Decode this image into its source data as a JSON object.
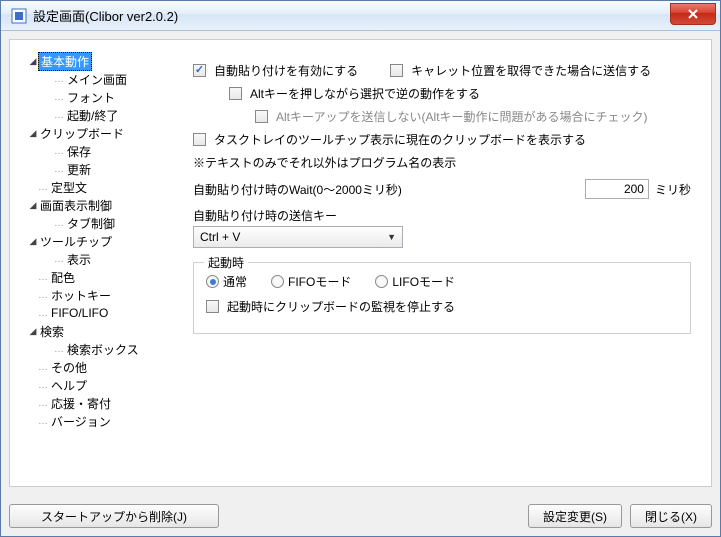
{
  "window": {
    "title": "設定画面(Clibor ver2.0.2)"
  },
  "tree": {
    "items": [
      {
        "label": "基本動作",
        "level": 1,
        "expandable": true,
        "selected": true
      },
      {
        "label": "メイン画面",
        "level": 2
      },
      {
        "label": "フォント",
        "level": 2
      },
      {
        "label": "起動/終了",
        "level": 2
      },
      {
        "label": "クリップボード",
        "level": 1,
        "expandable": true
      },
      {
        "label": "保存",
        "level": 2
      },
      {
        "label": "更新",
        "level": 2
      },
      {
        "label": "定型文",
        "level": 1
      },
      {
        "label": "画面表示制御",
        "level": 1,
        "expandable": true
      },
      {
        "label": "タブ制御",
        "level": 2
      },
      {
        "label": "ツールチップ",
        "level": 1,
        "expandable": true
      },
      {
        "label": "表示",
        "level": 2
      },
      {
        "label": "配色",
        "level": 1
      },
      {
        "label": "ホットキー",
        "level": 1
      },
      {
        "label": "FIFO/LIFO",
        "level": 1
      },
      {
        "label": "検索",
        "level": 1,
        "expandable": true
      },
      {
        "label": "検索ボックス",
        "level": 2
      },
      {
        "label": "その他",
        "level": 1
      },
      {
        "label": "ヘルプ",
        "level": 1
      },
      {
        "label": "応援・寄付",
        "level": 1
      },
      {
        "label": "バージョン",
        "level": 1
      }
    ]
  },
  "content": {
    "cb_autopaste": "自動貼り付けを有効にする",
    "cb_caret": "キャレット位置を取得できた場合に送信する",
    "cb_alt_reverse": "Altキーを押しながら選択で逆の動作をする",
    "cb_alt_keyup": "Altキーアップを送信しない(Altキー動作に問題がある場合にチェック)",
    "cb_tooltip_clip": "タスクトレイのツールチップ表示に現在のクリップボードを表示する",
    "note_textonly": "※テキストのみでそれ以外はプログラム名の表示",
    "wait_label": "自動貼り付け時のWait(0～2000ミリ秒)",
    "wait_value": "200",
    "wait_unit": "ミリ秒",
    "sendkey_label": "自動貼り付け時の送信キー",
    "sendkey_value": "Ctrl + V",
    "startup": {
      "legend": "起動時",
      "r_normal": "通常",
      "r_fifo": "FIFOモード",
      "r_lifo": "LIFOモード",
      "cb_stop_monitor": "起動時にクリップボードの監視を停止する"
    }
  },
  "buttons": {
    "delete_startup": "スタートアップから削除(J)",
    "apply": "設定変更(S)",
    "close": "閉じる(X)"
  }
}
